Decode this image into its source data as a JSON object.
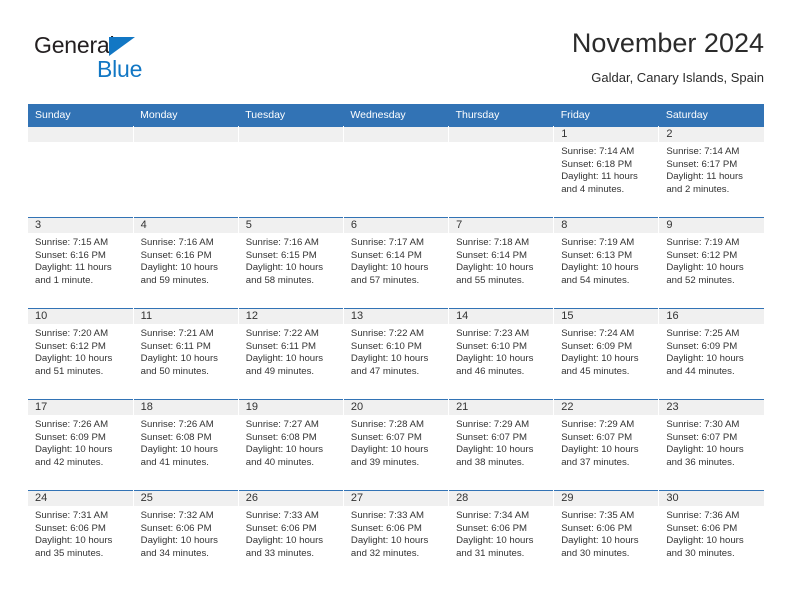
{
  "brand": {
    "name_part1": "General",
    "name_part2": "Blue",
    "triangle_color": "#1277c4"
  },
  "header": {
    "title": "November 2024",
    "subtitle": "Galdar, Canary Islands, Spain",
    "accent_color": "#3273b5"
  },
  "calendar": {
    "weekday_headers": [
      "Sunday",
      "Monday",
      "Tuesday",
      "Wednesday",
      "Thursday",
      "Friday",
      "Saturday"
    ],
    "weeks": [
      [
        {
          "day": "",
          "empty": true
        },
        {
          "day": "",
          "empty": true
        },
        {
          "day": "",
          "empty": true
        },
        {
          "day": "",
          "empty": true
        },
        {
          "day": "",
          "empty": true
        },
        {
          "day": "1",
          "sunrise": "Sunrise: 7:14 AM",
          "sunset": "Sunset: 6:18 PM",
          "daylight": "Daylight: 11 hours and 4 minutes."
        },
        {
          "day": "2",
          "sunrise": "Sunrise: 7:14 AM",
          "sunset": "Sunset: 6:17 PM",
          "daylight": "Daylight: 11 hours and 2 minutes."
        }
      ],
      [
        {
          "day": "3",
          "sunrise": "Sunrise: 7:15 AM",
          "sunset": "Sunset: 6:16 PM",
          "daylight": "Daylight: 11 hours and 1 minute."
        },
        {
          "day": "4",
          "sunrise": "Sunrise: 7:16 AM",
          "sunset": "Sunset: 6:16 PM",
          "daylight": "Daylight: 10 hours and 59 minutes."
        },
        {
          "day": "5",
          "sunrise": "Sunrise: 7:16 AM",
          "sunset": "Sunset: 6:15 PM",
          "daylight": "Daylight: 10 hours and 58 minutes."
        },
        {
          "day": "6",
          "sunrise": "Sunrise: 7:17 AM",
          "sunset": "Sunset: 6:14 PM",
          "daylight": "Daylight: 10 hours and 57 minutes."
        },
        {
          "day": "7",
          "sunrise": "Sunrise: 7:18 AM",
          "sunset": "Sunset: 6:14 PM",
          "daylight": "Daylight: 10 hours and 55 minutes."
        },
        {
          "day": "8",
          "sunrise": "Sunrise: 7:19 AM",
          "sunset": "Sunset: 6:13 PM",
          "daylight": "Daylight: 10 hours and 54 minutes."
        },
        {
          "day": "9",
          "sunrise": "Sunrise: 7:19 AM",
          "sunset": "Sunset: 6:12 PM",
          "daylight": "Daylight: 10 hours and 52 minutes."
        }
      ],
      [
        {
          "day": "10",
          "sunrise": "Sunrise: 7:20 AM",
          "sunset": "Sunset: 6:12 PM",
          "daylight": "Daylight: 10 hours and 51 minutes."
        },
        {
          "day": "11",
          "sunrise": "Sunrise: 7:21 AM",
          "sunset": "Sunset: 6:11 PM",
          "daylight": "Daylight: 10 hours and 50 minutes."
        },
        {
          "day": "12",
          "sunrise": "Sunrise: 7:22 AM",
          "sunset": "Sunset: 6:11 PM",
          "daylight": "Daylight: 10 hours and 49 minutes."
        },
        {
          "day": "13",
          "sunrise": "Sunrise: 7:22 AM",
          "sunset": "Sunset: 6:10 PM",
          "daylight": "Daylight: 10 hours and 47 minutes."
        },
        {
          "day": "14",
          "sunrise": "Sunrise: 7:23 AM",
          "sunset": "Sunset: 6:10 PM",
          "daylight": "Daylight: 10 hours and 46 minutes."
        },
        {
          "day": "15",
          "sunrise": "Sunrise: 7:24 AM",
          "sunset": "Sunset: 6:09 PM",
          "daylight": "Daylight: 10 hours and 45 minutes."
        },
        {
          "day": "16",
          "sunrise": "Sunrise: 7:25 AM",
          "sunset": "Sunset: 6:09 PM",
          "daylight": "Daylight: 10 hours and 44 minutes."
        }
      ],
      [
        {
          "day": "17",
          "sunrise": "Sunrise: 7:26 AM",
          "sunset": "Sunset: 6:09 PM",
          "daylight": "Daylight: 10 hours and 42 minutes."
        },
        {
          "day": "18",
          "sunrise": "Sunrise: 7:26 AM",
          "sunset": "Sunset: 6:08 PM",
          "daylight": "Daylight: 10 hours and 41 minutes."
        },
        {
          "day": "19",
          "sunrise": "Sunrise: 7:27 AM",
          "sunset": "Sunset: 6:08 PM",
          "daylight": "Daylight: 10 hours and 40 minutes."
        },
        {
          "day": "20",
          "sunrise": "Sunrise: 7:28 AM",
          "sunset": "Sunset: 6:07 PM",
          "daylight": "Daylight: 10 hours and 39 minutes."
        },
        {
          "day": "21",
          "sunrise": "Sunrise: 7:29 AM",
          "sunset": "Sunset: 6:07 PM",
          "daylight": "Daylight: 10 hours and 38 minutes."
        },
        {
          "day": "22",
          "sunrise": "Sunrise: 7:29 AM",
          "sunset": "Sunset: 6:07 PM",
          "daylight": "Daylight: 10 hours and 37 minutes."
        },
        {
          "day": "23",
          "sunrise": "Sunrise: 7:30 AM",
          "sunset": "Sunset: 6:07 PM",
          "daylight": "Daylight: 10 hours and 36 minutes."
        }
      ],
      [
        {
          "day": "24",
          "sunrise": "Sunrise: 7:31 AM",
          "sunset": "Sunset: 6:06 PM",
          "daylight": "Daylight: 10 hours and 35 minutes."
        },
        {
          "day": "25",
          "sunrise": "Sunrise: 7:32 AM",
          "sunset": "Sunset: 6:06 PM",
          "daylight": "Daylight: 10 hours and 34 minutes."
        },
        {
          "day": "26",
          "sunrise": "Sunrise: 7:33 AM",
          "sunset": "Sunset: 6:06 PM",
          "daylight": "Daylight: 10 hours and 33 minutes."
        },
        {
          "day": "27",
          "sunrise": "Sunrise: 7:33 AM",
          "sunset": "Sunset: 6:06 PM",
          "daylight": "Daylight: 10 hours and 32 minutes."
        },
        {
          "day": "28",
          "sunrise": "Sunrise: 7:34 AM",
          "sunset": "Sunset: 6:06 PM",
          "daylight": "Daylight: 10 hours and 31 minutes."
        },
        {
          "day": "29",
          "sunrise": "Sunrise: 7:35 AM",
          "sunset": "Sunset: 6:06 PM",
          "daylight": "Daylight: 10 hours and 30 minutes."
        },
        {
          "day": "30",
          "sunrise": "Sunrise: 7:36 AM",
          "sunset": "Sunset: 6:06 PM",
          "daylight": "Daylight: 10 hours and 30 minutes."
        }
      ]
    ]
  }
}
